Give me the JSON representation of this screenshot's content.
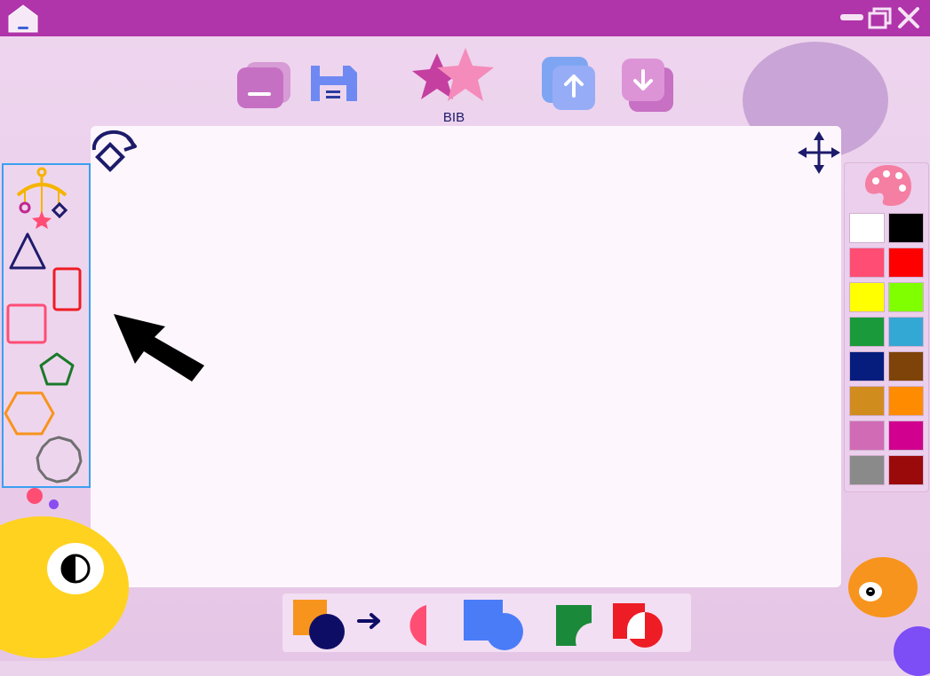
{
  "toolbar": {
    "center_label": "BIB"
  },
  "icons": {
    "home": "home-icon",
    "minimize": "minimize-icon",
    "restore": "restore-icon",
    "close": "close-icon",
    "delete": "delete-icon",
    "save": "save-icon",
    "stars": "stars-icon",
    "bring_forward": "arrow-up-icon",
    "send_backward": "arrow-down-icon",
    "rotate": "rotate-icon",
    "move": "move-icon",
    "palette": "palette-icon",
    "mobile": "mobile-icon",
    "contrast": "contrast-icon",
    "eye": "eye-icon"
  },
  "palette_colors": [
    "#ffffff",
    "#000000",
    "#ff4d74",
    "#ff0000",
    "#ffff00",
    "#80ff00",
    "#1a9a3a",
    "#34a8d4",
    "#061d7e",
    "#7d4309",
    "#d18c1e",
    "#ff8c00",
    "#d16bb5",
    "#d1008e",
    "#8a8a8a",
    "#9a0a0a"
  ],
  "colors": {
    "titlebar": "#b034aa",
    "panel_border": "#3b9ff0",
    "icon_navy": "#1d1b6b",
    "yellow_blob": "#ffd21f",
    "orange_blob": "#f7941d"
  }
}
